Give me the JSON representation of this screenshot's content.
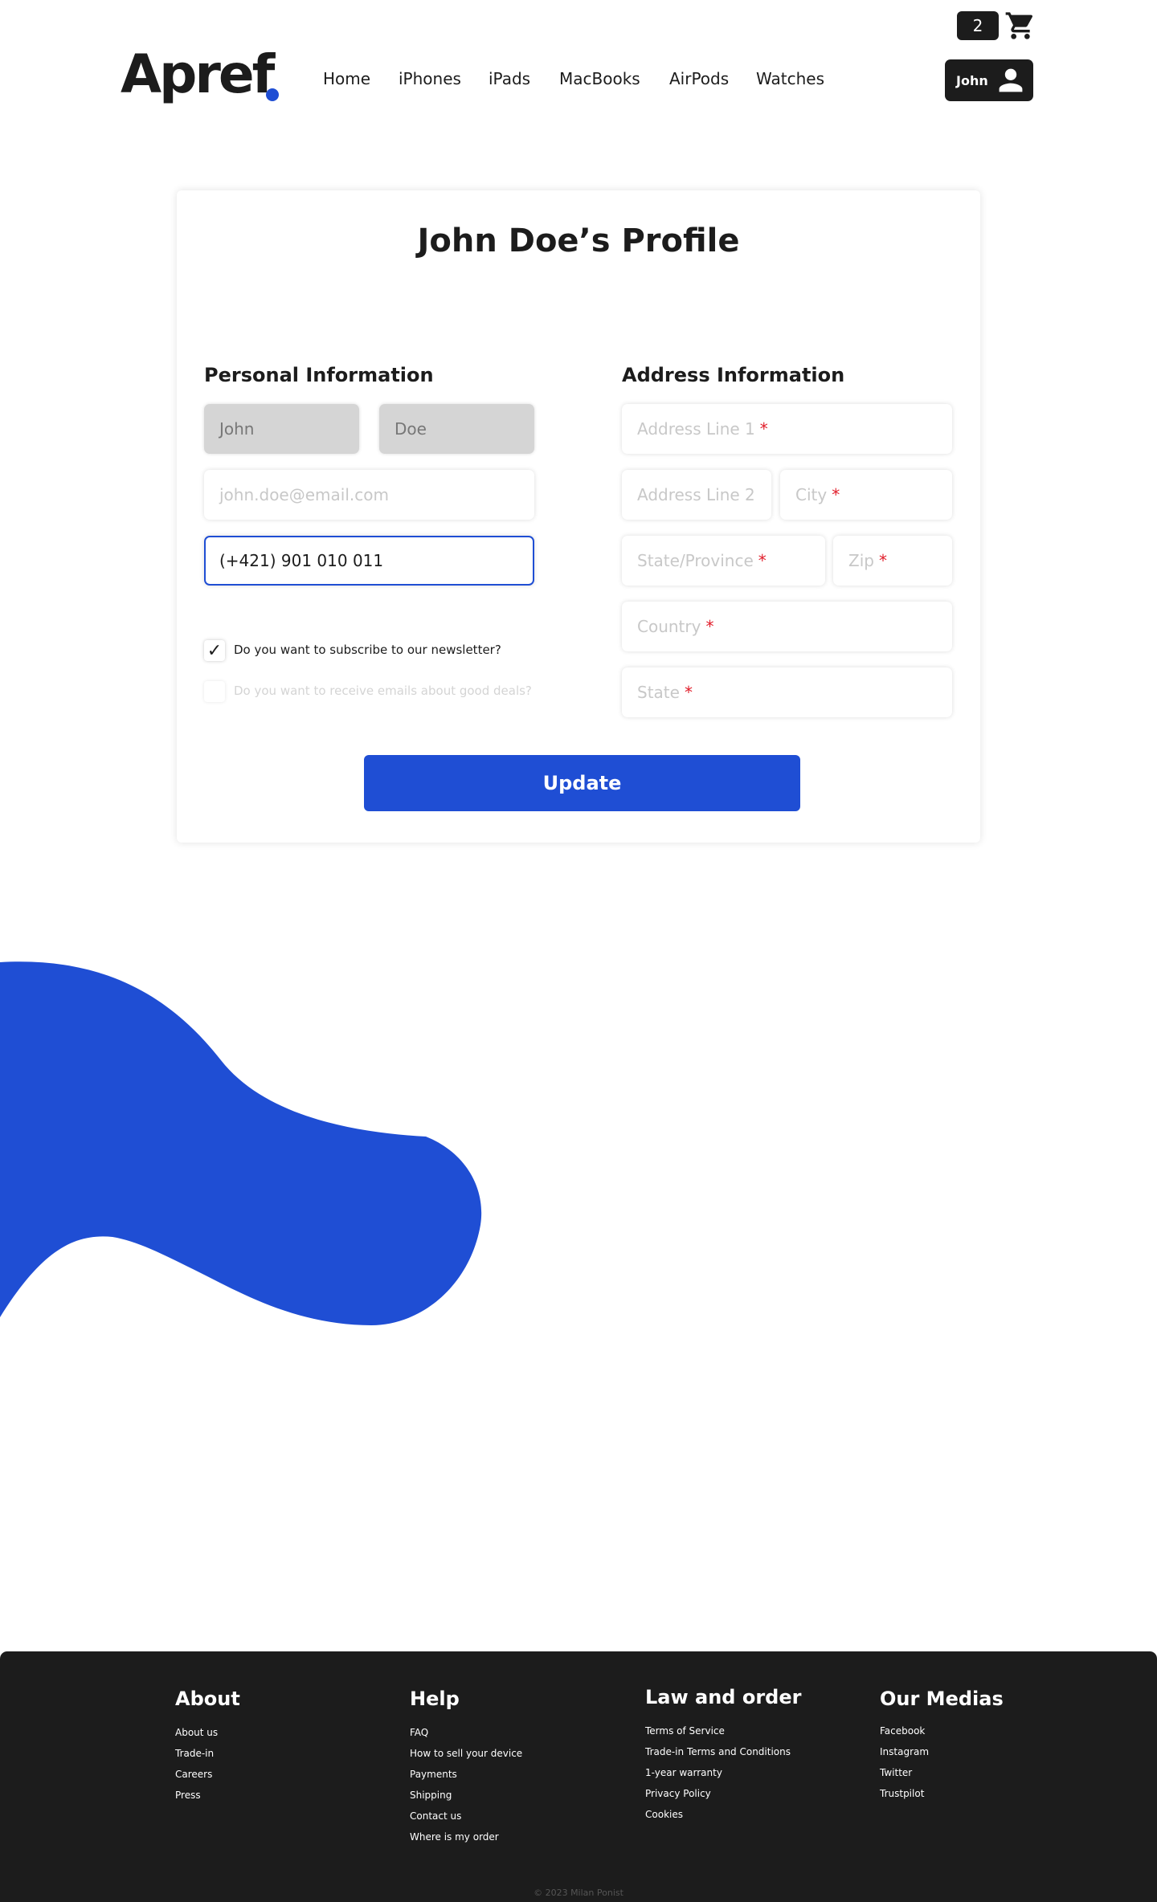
{
  "header": {
    "cart_count": "2",
    "cart_icon": "shopping-cart-icon",
    "logo": "Apref",
    "nav": [
      "Home",
      "iPhones",
      "iPads",
      "MacBooks",
      "AirPods",
      "Watches"
    ],
    "user_label": "John",
    "user_icon": "person-icon"
  },
  "profile": {
    "title": "John Doe’s Profile",
    "personal": {
      "title": "Personal Information",
      "first_name": "John",
      "last_name": "Doe",
      "email_placeholder": "john.doe@email.com",
      "phone": "(+421) 901 010 011"
    },
    "address": {
      "title": "Address Information",
      "line1": "Address Line 1",
      "line2": "Address Line 2",
      "city": "City",
      "state_province": "State/Province",
      "zip": "Zip",
      "country": "Country",
      "state": "State",
      "required_mark": "*"
    },
    "newsletter": {
      "label": "Do you want to subscribe to our newsletter?",
      "checked": true,
      "mark": "✓"
    },
    "deals": {
      "label": "Do you want to receive emails about good deals?",
      "checked": false
    },
    "update_label": "Update"
  },
  "footer": {
    "about": {
      "title": "About",
      "links": [
        "About us",
        "Trade-in",
        "Careers",
        "Press"
      ]
    },
    "help": {
      "title": "Help",
      "links": [
        "FAQ",
        "How to sell your device",
        "Payments",
        "Shipping",
        "Contact us",
        "Where is my order"
      ]
    },
    "law": {
      "title": "Law and order",
      "links": [
        "Terms of Service",
        "Trade-in Terms and Conditions",
        "1-year warranty",
        "Privacy Policy",
        "Cookies"
      ]
    },
    "media": {
      "title": "Our Medias",
      "links": [
        "Facebook",
        "Instagram",
        "Twitter",
        "Trustpilot"
      ]
    },
    "copyright": "© 2023 Milan Ponist"
  },
  "colors": {
    "accent": "#1f4ed4",
    "dark": "#1c1c1c",
    "required": "#e11d2a"
  }
}
